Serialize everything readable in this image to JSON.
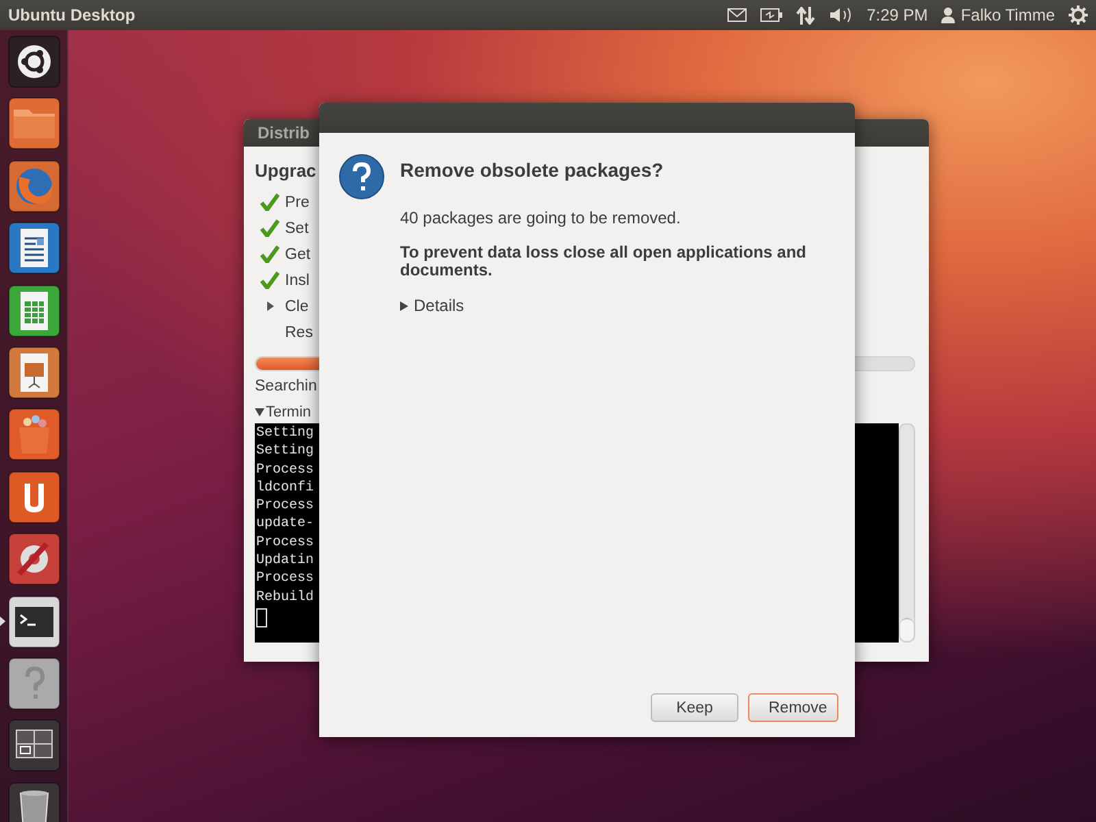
{
  "top_panel": {
    "title": "Ubuntu Desktop",
    "time": "7:29 PM",
    "user": "Falko Timme"
  },
  "launcher": [
    {
      "kind": "ubuntu",
      "running": false
    },
    {
      "kind": "folder",
      "running": false
    },
    {
      "kind": "browser",
      "running": false
    },
    {
      "kind": "writer",
      "running": false
    },
    {
      "kind": "calc",
      "running": false
    },
    {
      "kind": "impress",
      "running": false
    },
    {
      "kind": "shop",
      "running": false
    },
    {
      "kind": "one",
      "running": false
    },
    {
      "kind": "settings",
      "running": false
    },
    {
      "kind": "terminal",
      "running": true
    },
    {
      "kind": "help",
      "running": false
    },
    {
      "kind": "workspaces",
      "running": false
    },
    {
      "kind": "trash",
      "running": false
    }
  ],
  "upgrade_window": {
    "title": "Distrib",
    "heading": "Upgrac",
    "steps": [
      {
        "label": "Pre",
        "done": true,
        "active": false
      },
      {
        "label": "Set",
        "done": true,
        "active": false
      },
      {
        "label": "Get",
        "done": true,
        "active": false
      },
      {
        "label": "Insl",
        "done": true,
        "active": false
      },
      {
        "label": "Cle",
        "done": false,
        "active": true
      },
      {
        "label": "Res",
        "done": false,
        "active": false
      }
    ],
    "progress": {
      "level": 0.91
    },
    "status_text": "Searchin",
    "terminal": {
      "label": "Termin",
      "expanded": true,
      "lines": [
        "Setting",
        "Setting",
        "Process",
        "ldconfi",
        "Process",
        "update-",
        "Process",
        "Updatin",
        "Process",
        "Rebuild"
      ]
    }
  },
  "dialog": {
    "title": "Remove obsolete packages?",
    "message": "40 packages are going to be removed.",
    "warning": "To prevent data loss close all open applications and documents.",
    "details": {
      "label": "Details",
      "expanded": false
    },
    "buttons": [
      {
        "label": "Keep",
        "default": false
      },
      {
        "label": "Remove",
        "default": true
      }
    ]
  }
}
